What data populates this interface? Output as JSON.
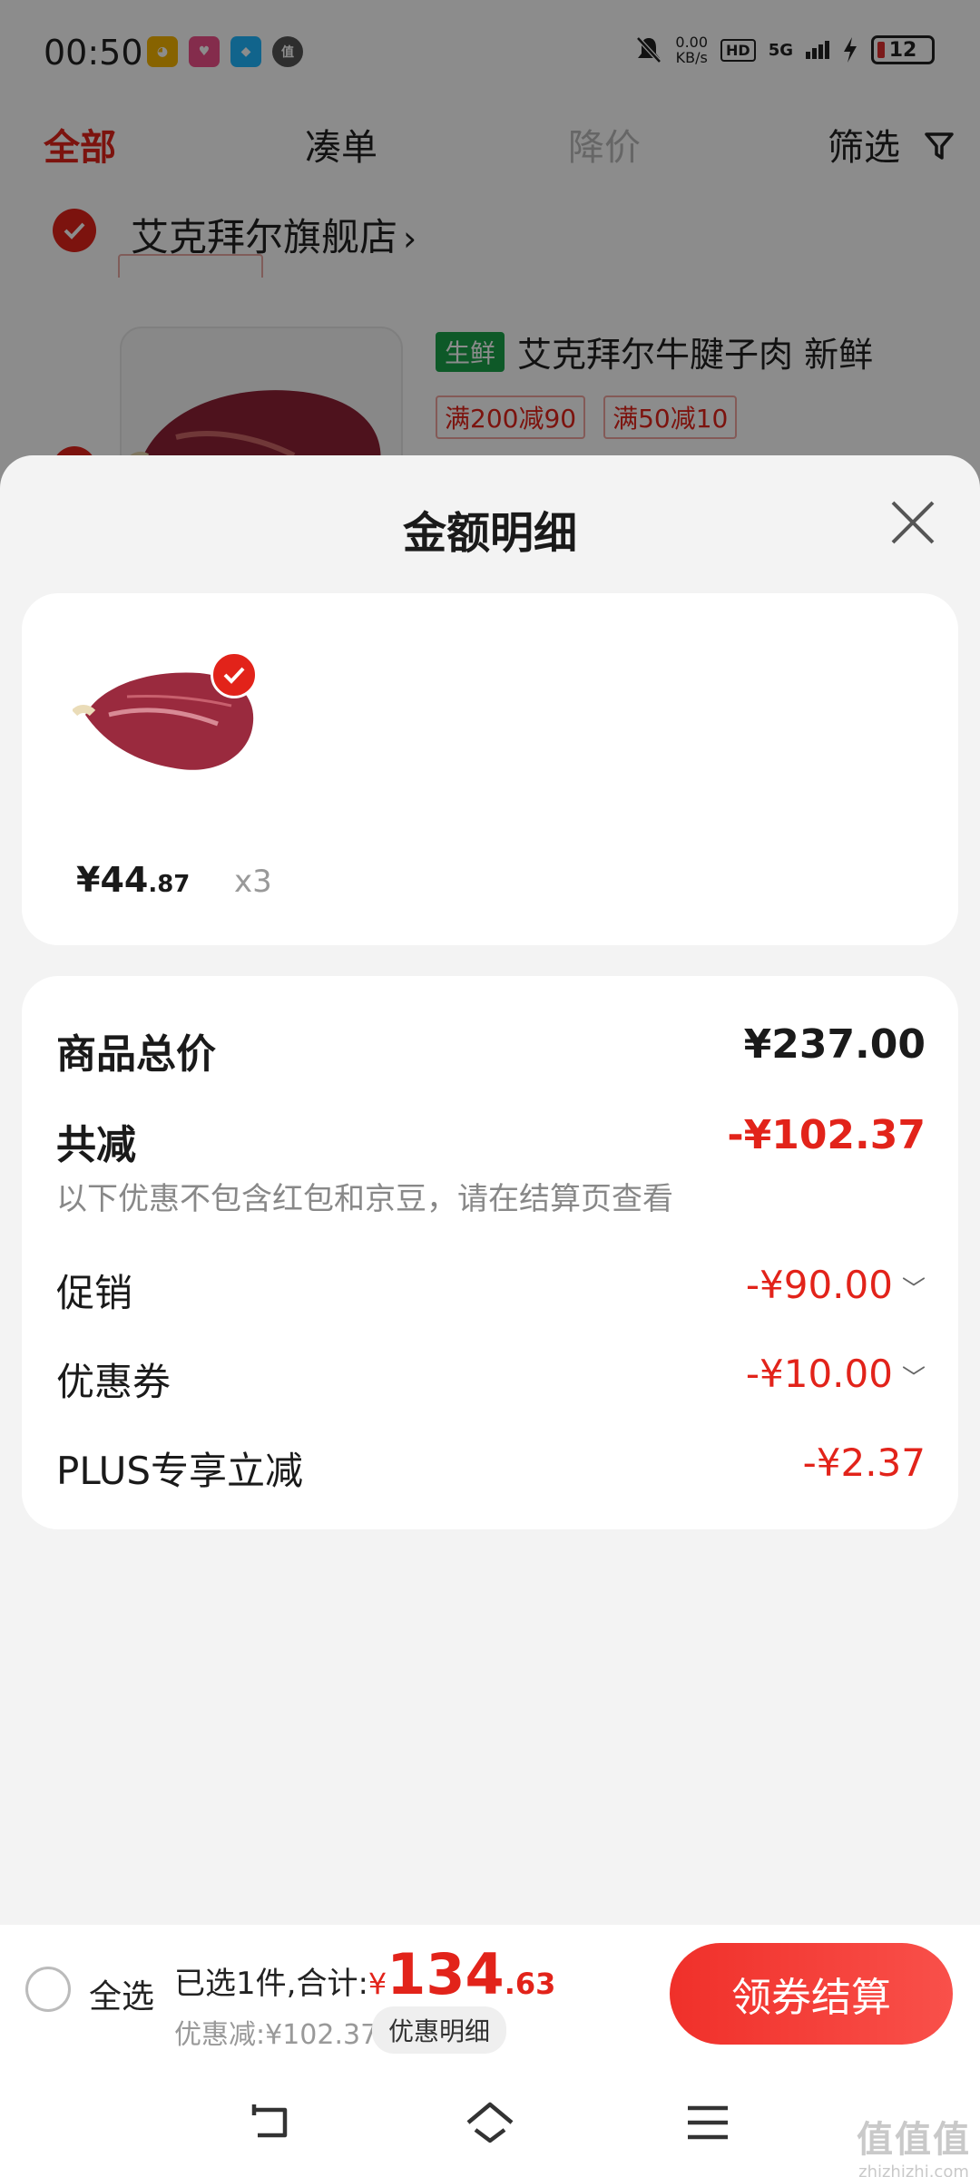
{
  "status_bar": {
    "time": "00:50",
    "net_speed_value": "0.00",
    "net_speed_unit": "KB/s",
    "hd": "HD",
    "network": "5G",
    "battery": "12"
  },
  "top_tabs": {
    "all": "全部",
    "bundle": "凑单",
    "price_drop": "降价",
    "filter": "筛选"
  },
  "store": {
    "name": "艾克拜尔旗舰店",
    "chevron": "›"
  },
  "product": {
    "badge": "生鲜",
    "title": "艾克拜尔牛腱子肉  新鲜",
    "promo_tags": [
      "满200减90",
      "满50减10"
    ]
  },
  "sheet": {
    "title": "金额明细",
    "item": {
      "price_currency": "¥",
      "price_int": "44",
      "price_dec": ".87",
      "qty": "x3"
    },
    "summary": {
      "total_label": "商品总价",
      "total_value": "¥237.00",
      "reduce_label": "共减",
      "reduce_value": "-¥102.37",
      "reduce_note": "以下优惠不包含红包和京豆，请在结算页查看",
      "promo_label": "促销",
      "promo_value": "-¥90.00",
      "coupon_label": "优惠券",
      "coupon_value": "-¥10.00",
      "plus_label": "PLUS专享立减",
      "plus_value": "-¥2.37"
    }
  },
  "bottom_bar": {
    "select_all": "全选",
    "selected_text": "已选1件,合计:",
    "total_currency": "¥",
    "total_int": "134",
    "total_dec": ".63",
    "discount_text": "优惠减:¥102.37",
    "detail_chip": "优惠明细",
    "checkout": "领券结算"
  },
  "watermark": {
    "main": "值值值",
    "sub": "zhizhizhi.com"
  },
  "colors": {
    "accent_red": "#e2231a",
    "fresh_green": "#1aa34a"
  }
}
